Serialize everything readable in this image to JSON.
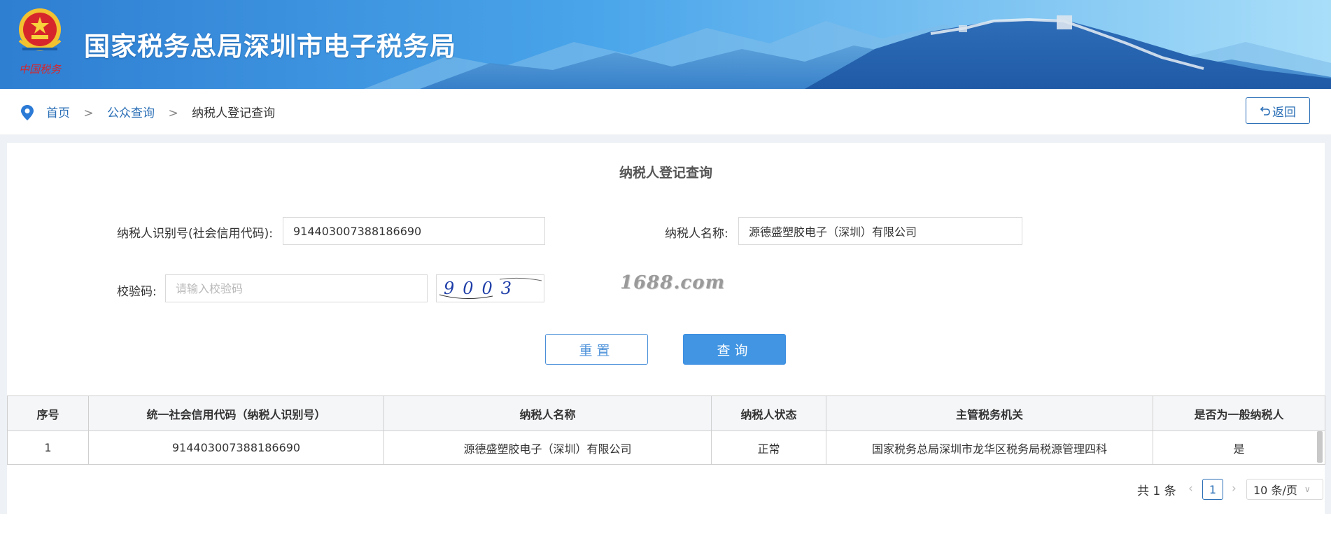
{
  "header": {
    "title": "国家税务总局深圳市电子税务局",
    "emblem_text": "中国税务",
    "colors": {
      "banner_start": "#2f7fd3",
      "banner_end": "#9fd9fa"
    }
  },
  "breadcrumb": {
    "icon": "location-pin-icon",
    "items": [
      "首页",
      "公众查询",
      "纳税人登记查询"
    ],
    "separator": ">"
  },
  "back_button": {
    "label": "返回",
    "icon": "return-arrow-icon"
  },
  "form": {
    "title": "纳税人登记查询",
    "taxpayer_id_label": "纳税人识别号(社会信用代码):",
    "taxpayer_id_value": "914403007388186690",
    "taxpayer_name_label": "纳税人名称:",
    "taxpayer_name_value": "源德盛塑胶电子（深圳）有限公司",
    "captcha_label": "校验码:",
    "captcha_placeholder": "请输入校验码",
    "captcha_text": "9003",
    "watermark": "1688.com",
    "reset_label": "重置",
    "query_label": "查询"
  },
  "table": {
    "headers": [
      "序号",
      "统一社会信用代码（纳税人识别号）",
      "纳税人名称",
      "纳税人状态",
      "主管税务机关",
      "是否为一般纳税人"
    ],
    "rows": [
      [
        "1",
        "914403007388186690",
        "源德盛塑胶电子（深圳）有限公司",
        "正常",
        "国家税务总局深圳市龙华区税务局税源管理四科",
        "是"
      ]
    ]
  },
  "pagination": {
    "total": "共 1 条",
    "current_page": "1",
    "page_size": "10 条/页",
    "prev_icon": "chevron-left-icon",
    "next_icon": "chevron-right-icon"
  },
  "colors": {
    "accent": "#2b6fb6",
    "primary_button": "#4195e3",
    "page_bg": "#eef1f5"
  }
}
